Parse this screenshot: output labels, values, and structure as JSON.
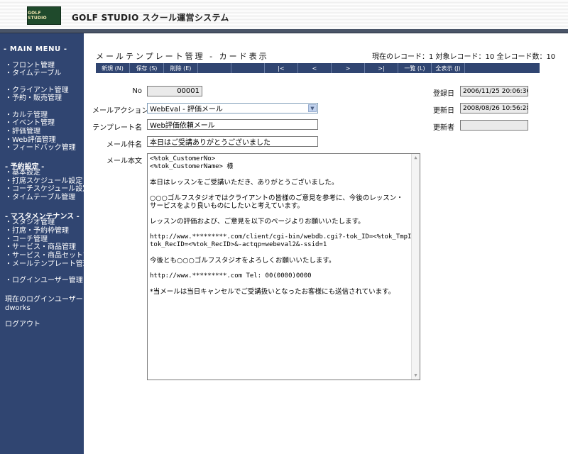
{
  "header": {
    "logo_text": "GOLF STUDIO",
    "app_title": "GOLF STUDIO スクール運営システム"
  },
  "sidebar": {
    "main_menu": "- MAIN MENU -",
    "group1": [
      "・フロント管理",
      "・タイムテーブル"
    ],
    "group2": [
      "・クライアント管理",
      "・予約・販売管理"
    ],
    "group3": [
      "・カルテ管理",
      "・イベント管理",
      "・評価管理",
      "・Web評価管理",
      "・フィードバック管理"
    ],
    "settings_head": "- 予約設定 -",
    "group4": [
      "・基本設定",
      "・打席スケジュール設定",
      "・コーチスケジュール設定",
      "・タイムテーブル管理"
    ],
    "master_head": "- マスタメンテナンス -",
    "group5": [
      "・スタジオ管理",
      "・打席・予約枠管理",
      "・コーチ管理",
      "・サービス・商品管理",
      "・サービス・商品セット管理",
      "・メールテンプレート管理"
    ],
    "login_user_mgmt": "・ログインユーザー管理",
    "current_user_label": "現在のログインユーザー",
    "current_user": "dworks",
    "logout": "ログアウト"
  },
  "main": {
    "page_title": "メールテンプレート管理 - カード表示",
    "record_info": "現在のレコード：1  対象レコード：10  全レコード数：10",
    "toolbar": {
      "new": "新規 (N)",
      "save": "保存 (S)",
      "delete": "削除 (E)",
      "first": "|<",
      "prev": "<",
      "next": ">",
      "last": ">|",
      "list": "一覧 (L)",
      "show_all": "全表示 (J)"
    },
    "form": {
      "no_label": "No",
      "no_value": "00001",
      "action_label": "メールアクション",
      "action_value": "WebEval - 評価メール",
      "template_label": "テンプレート名",
      "template_value": "Web評価依頼メール",
      "subject_label": "メール件名",
      "subject_value": "本日はご受講ありがとうございました",
      "body_label": "メール本文",
      "registered_label": "登録日",
      "registered_value": "2006/11/25 20:06:36",
      "updated_label": "更新日",
      "updated_value": "2008/08/26 10:56:28",
      "updater_label": "更新者",
      "updater_value": ""
    },
    "body_lines": [
      "<%tok_CustomerNo>",
      "<%tok_CustomerName> 様",
      "",
      "本日はレッスンをご受講いただき、ありがとうございました。",
      "",
      "○○○ゴルフスタジオではクライアントの皆様のご意見を参考に、今後のレッスン・",
      "サービスをより良いものにしたいと考えています。",
      "",
      "レッスンの評価および、ご意見を以下のページよりお願いいたします。",
      "",
      "http://www.*********.com/client/cgi-bin/webdb.cgi?-tok_ID=<%tok_TmpID>&-",
      "tok_RecID=<%tok_RecID>&-actqp=webeval2&-ssid=1",
      "",
      "今後とも○○○ゴルフスタジオをよろしくお願いいたします。",
      "",
      "http://www.*********.com  Tel: 00(0000)0000",
      "",
      "*当メールは当日キャンセルでご受講扱いとなったお客様にも送信されています。"
    ]
  }
}
